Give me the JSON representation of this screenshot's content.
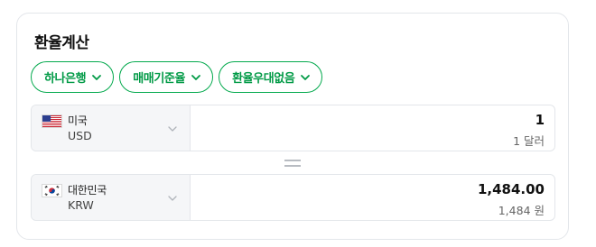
{
  "widget": {
    "title": "환율계산",
    "chips": [
      {
        "label": "하나은행"
      },
      {
        "label": "매매기준율"
      },
      {
        "label": "환율우대없음"
      }
    ],
    "from": {
      "country": "미국",
      "code": "USD",
      "flag_icon": "us-flag-icon",
      "amount": "1",
      "amount_text": "1 달러"
    },
    "equals_icon": "equals-icon",
    "to": {
      "country": "대한민국",
      "code": "KRW",
      "flag_icon": "kr-flag-icon",
      "amount": "1,484.00",
      "amount_text": "1,484 원"
    },
    "colors": {
      "accent": "#03a94d",
      "selector_bg": "#f5f6f8",
      "border": "#e3e6ea"
    }
  }
}
